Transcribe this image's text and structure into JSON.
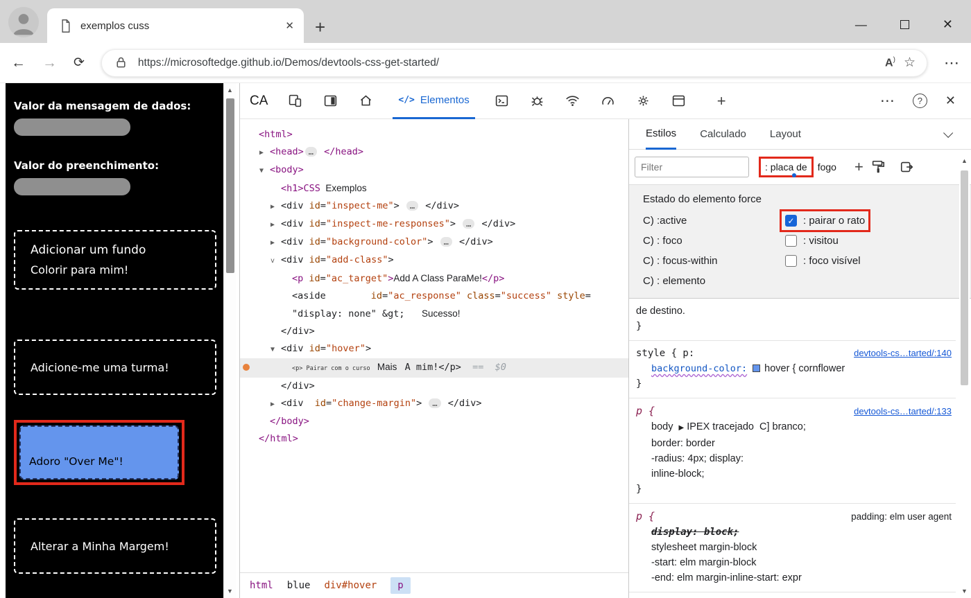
{
  "colors": {
    "annotation": "#e2291b",
    "cornflower": "#6495ed",
    "accent_blue": "#1967d2",
    "checkbox_blue": "#1665d8",
    "page_input_gray": "#8f8f8f"
  },
  "icons": {
    "scroll_up": "▲",
    "scroll_down": "▼",
    "back": "←",
    "forward": "→",
    "refresh": "⟳",
    "star": "☆",
    "read_aloud": "A",
    "read_aloud_sup": ")",
    "nav_more": "⋯",
    "minimize": "—",
    "win_close": "✕",
    "tab_close": "✕",
    "new_tab": "+",
    "inspect": "CA",
    "code": "</>",
    "plus": "+",
    "dt_more": "⋯",
    "dt_help": "?",
    "dt_close": "✕"
  },
  "chrome": {
    "tab_title": "exemplos cuss",
    "url": "https://microsoftedge.github.io/Demos/devtools-css-get-started/"
  },
  "page": {
    "data_label": "Valor da mensagem de dados:",
    "padding_label": "Valor do preenchimento:",
    "background_button": [
      "Adicionar um fundo",
      "Colorir para mim!"
    ],
    "class_button": "Adicione-me uma turma!",
    "hover_button": "Adoro \"Over Me\"!",
    "margin_button": "Alterar a Minha Margem!"
  },
  "devtools": {
    "elements_tab": "Elementos",
    "tree": [
      {
        "ind": 0,
        "parts": [
          [
            "tag",
            "<html>"
          ]
        ]
      },
      {
        "ind": 1,
        "arrow": "▶",
        "parts": [
          [
            "tag",
            "<head>"
          ],
          [
            "ell",
            "…"
          ],
          [
            "tag",
            " </head>"
          ]
        ]
      },
      {
        "ind": 1,
        "arrow": "▼",
        "parts": [
          [
            "tag",
            "<body>"
          ]
        ]
      },
      {
        "ind": 2,
        "parts": [
          [
            "tag",
            "<h1>"
          ],
          [
            "tag",
            "CSS"
          ],
          [
            "text",
            "  Exemplos"
          ]
        ]
      },
      {
        "ind": 2,
        "arrow": "▶",
        "parts": [
          [
            "mono",
            "<div "
          ],
          [
            "attr",
            "id"
          ],
          [
            "mono",
            "="
          ],
          [
            "val",
            "\"inspect-me\""
          ],
          [
            "mono",
            "> "
          ],
          [
            "ell",
            "…"
          ],
          [
            "mono",
            " </div>"
          ]
        ]
      },
      {
        "ind": 2,
        "arrow": "▶",
        "parts": [
          [
            "mono",
            "<div "
          ],
          [
            "attr",
            "id"
          ],
          [
            "mono",
            "="
          ],
          [
            "val",
            "\"inspect-me-responses\""
          ],
          [
            "mono",
            "> "
          ],
          [
            "ell",
            "…"
          ],
          [
            "mono",
            " </div>"
          ]
        ]
      },
      {
        "ind": 2,
        "arrow": "▶",
        "parts": [
          [
            "mono",
            "<div "
          ],
          [
            "attr",
            "id"
          ],
          [
            "mono",
            "="
          ],
          [
            "val",
            "\"background-color\""
          ],
          [
            "mono",
            "> "
          ],
          [
            "ell",
            "…"
          ],
          [
            "mono",
            " </div>"
          ]
        ]
      },
      {
        "ind": 2,
        "arrow": "v",
        "parts": [
          [
            "mono",
            "<div "
          ],
          [
            "attr",
            "id"
          ],
          [
            "mono",
            "="
          ],
          [
            "val",
            "\"add-class\""
          ],
          [
            "mono",
            ">"
          ]
        ]
      },
      {
        "ind": 3,
        "parts": [
          [
            "tag",
            "<p "
          ],
          [
            "attr",
            "id"
          ],
          [
            "mono",
            "="
          ],
          [
            "val",
            "\"ac_target\""
          ],
          [
            "tag",
            ">"
          ],
          [
            "text",
            "Add A Class ParaMe!"
          ],
          [
            "tag",
            "</p>"
          ]
        ]
      },
      {
        "ind": 3,
        "parts": [
          [
            "mono",
            "<aside        "
          ],
          [
            "attr",
            "id"
          ],
          [
            "mono",
            "="
          ],
          [
            "val",
            "\"ac_response\""
          ],
          [
            "mono",
            " "
          ],
          [
            "attr",
            "class"
          ],
          [
            "mono",
            "="
          ],
          [
            "val",
            "\"success\""
          ],
          [
            "mono",
            " "
          ],
          [
            "attr",
            "style"
          ],
          [
            "mono",
            "="
          ]
        ]
      },
      {
        "ind": 3,
        "parts": [
          [
            "mono",
            "\"display: none\" &gt;   "
          ],
          [
            "text",
            "Sucesso!"
          ]
        ]
      },
      {
        "ind": 2,
        "parts": [
          [
            "mono",
            "</div>"
          ]
        ]
      },
      {
        "ind": 2,
        "arrow": "▼",
        "parts": [
          [
            "mono",
            "<div "
          ],
          [
            "attr",
            "id"
          ],
          [
            "mono",
            "="
          ],
          [
            "val",
            "\"hover\""
          ],
          [
            "mono",
            ">"
          ]
        ]
      },
      {
        "ind": 3,
        "selected": true,
        "dot": true,
        "parts": [
          [
            "small",
            "<p> Pairar com o curso  "
          ],
          [
            "text",
            "Mais   "
          ],
          [
            "mono",
            "A mim!</p>"
          ],
          [
            "dim",
            "  ==  $0"
          ]
        ]
      },
      {
        "ind": 2,
        "parts": [
          [
            "mono",
            "</div>"
          ]
        ]
      },
      {
        "ind": 2,
        "arrow": "▶",
        "parts": [
          [
            "mono",
            "<div  "
          ],
          [
            "attr",
            "id"
          ],
          [
            "mono",
            "="
          ],
          [
            "val",
            "\"change-margin\""
          ],
          [
            "mono",
            "> "
          ],
          [
            "ell",
            "…"
          ],
          [
            "mono",
            " </div>"
          ]
        ]
      },
      {
        "ind": 1,
        "parts": [
          [
            "tag",
            "</body>"
          ]
        ]
      },
      {
        "ind": 0,
        "parts": [
          [
            "tag",
            "</html>"
          ]
        ]
      }
    ],
    "breadcrumbs": [
      {
        "label": "html",
        "type": "tag"
      },
      {
        "label": "blue",
        "type": "plain"
      },
      {
        "label": "div#hover",
        "type": "attr"
      },
      {
        "label": "p",
        "type": "selected"
      }
    ],
    "styles": {
      "tabs": [
        "Estilos",
        "Calculado",
        "Layout"
      ],
      "filter_placeholder": "Filter",
      "hov_button": ": placa de",
      "hov_suffix": "fogo",
      "force_title": "Estado do elemento force",
      "force_left": [
        "C) :active",
        "C) : foco",
        "C) : focus-within",
        "C) : elemento"
      ],
      "force_right": [
        {
          "label": ": pairar o rato",
          "checked": true,
          "highlighted": true
        },
        {
          "label": ": visitou",
          "checked": false
        },
        {
          "label": ": foco visível",
          "checked": false
        }
      ],
      "rules": [
        {
          "lines": [
            {
              "parts": [
                [
                  "plain",
                  "de destino."
                ]
              ]
            },
            {
              "parts": [
                [
                  "mono",
                  "}"
                ]
              ]
            }
          ]
        },
        {
          "header": [
            [
              "mono",
              "style { p:"
            ]
          ],
          "link": "devtools-cs…tarted/:140",
          "lines": [
            {
              "ind": true,
              "parts": [
                [
                  "prop",
                  "background-color:"
                ],
                [
                  "swatch",
                  "#6495ed"
                ],
                [
                  "plain",
                  "hover { cornflower"
                ]
              ]
            },
            {
              "parts": [
                [
                  "mono",
                  "}"
                ]
              ]
            }
          ]
        },
        {
          "header": [
            [
              "selp",
              "p {"
            ]
          ],
          "link": "devtools-cs…tarted/:133",
          "lines": [
            {
              "ind": true,
              "parts": [
                [
                  "plain",
                  "body  "
                ],
                [
                  "tri",
                  "▶"
                ],
                [
                  "plain",
                  " IPEX tracejado  C] branco;"
                ]
              ]
            },
            {
              "ind": true,
              "parts": [
                [
                  "plain",
                  "border: border"
                ]
              ]
            },
            {
              "ind": true,
              "parts": [
                [
                  "plain",
                  "-radius: 4px; display:"
                ]
              ]
            },
            {
              "ind": true,
              "parts": [
                [
                  "plain",
                  "inline-block;"
                ]
              ]
            },
            {
              "parts": [
                [
                  "mono",
                  "}"
                ]
              ]
            }
          ]
        },
        {
          "header": [
            [
              "selp",
              "p {"
            ]
          ],
          "right": "padding: elm user agent",
          "lines": [
            {
              "ind": true,
              "parts": [
                [
                  "strike",
                  "display: block;"
                ]
              ]
            },
            {
              "ind": true,
              "parts": [
                [
                  "plain",
                  "stylesheet margin-block"
                ]
              ]
            },
            {
              "ind": true,
              "parts": [
                [
                  "plain",
                  "-start: elm margin-block"
                ]
              ]
            },
            {
              "ind": true,
              "parts": [
                [
                  "plain",
                  "-end: elm margin-inline-start: expr"
                ]
              ]
            }
          ]
        }
      ]
    }
  }
}
